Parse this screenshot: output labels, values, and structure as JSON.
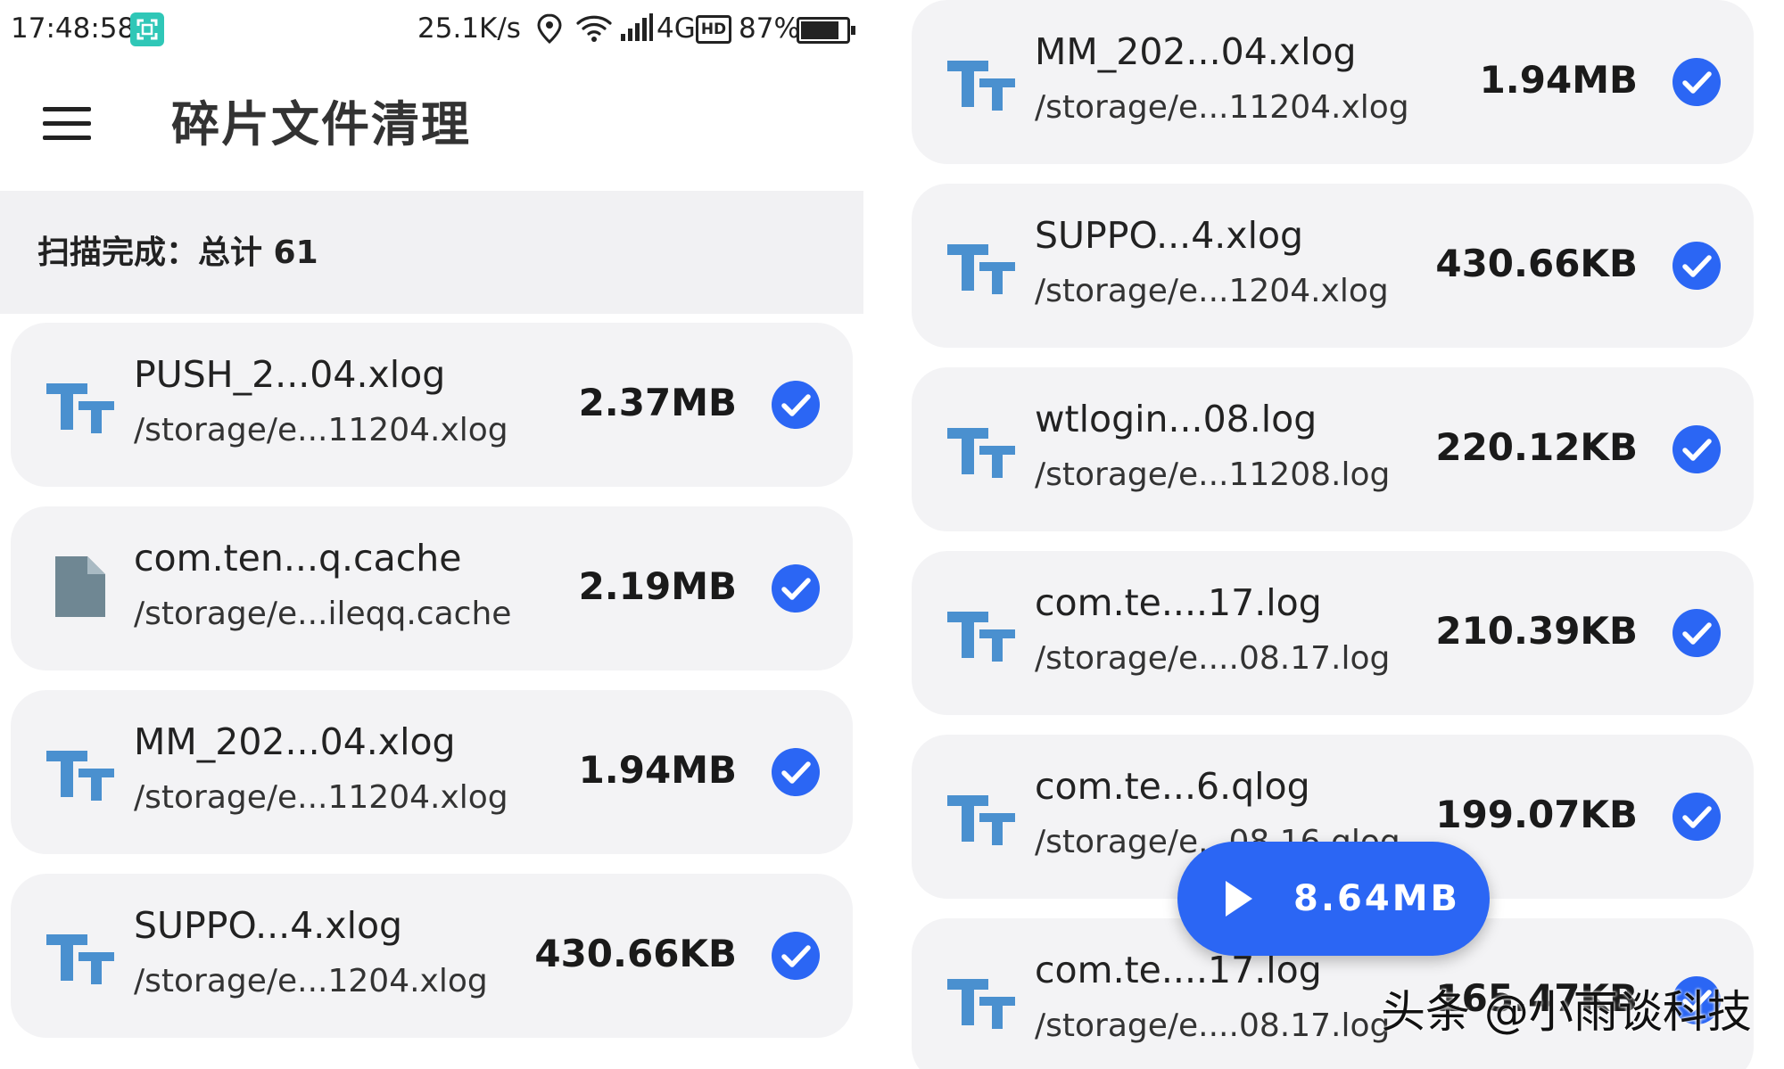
{
  "status_bar": {
    "time": "17:48:58",
    "speed": "25.1K/s",
    "network": "4G",
    "hd": "HD",
    "battery_pct": "87%",
    "battery_level": 0.87,
    "icons": [
      "screenshot-icon",
      "location-icon",
      "wifi-icon",
      "signal-icon",
      "battery-icon"
    ]
  },
  "app_bar": {
    "title": "碎片文件清理",
    "menu_icon": "hamburger-menu-icon"
  },
  "summary": {
    "text": "扫描完成：总计 61"
  },
  "left_list": [
    {
      "name": "PUSH_2...04.xlog",
      "path": "/storage/e...11204.xlog",
      "size": "2.37MB",
      "icon": "text-file-icon",
      "checked": true
    },
    {
      "name": "com.ten...q.cache",
      "path": "/storage/e...ileqq.cache",
      "size": "2.19MB",
      "icon": "generic-file-icon",
      "checked": true
    },
    {
      "name": "MM_202...04.xlog",
      "path": "/storage/e...11204.xlog",
      "size": "1.94MB",
      "icon": "text-file-icon",
      "checked": true
    },
    {
      "name": "SUPPO...4.xlog",
      "path": "/storage/e...1204.xlog",
      "size": "430.66KB",
      "icon": "text-file-icon",
      "checked": true
    }
  ],
  "right_list": [
    {
      "name": "MM_202...04.xlog",
      "path": "/storage/e...11204.xlog",
      "size": "1.94MB",
      "icon": "text-file-icon",
      "checked": true
    },
    {
      "name": "SUPPO...4.xlog",
      "path": "/storage/e...1204.xlog",
      "size": "430.66KB",
      "icon": "text-file-icon",
      "checked": true
    },
    {
      "name": "wtlogin...08.log",
      "path": "/storage/e...11208.log",
      "size": "220.12KB",
      "icon": "text-file-icon",
      "checked": true
    },
    {
      "name": "com.te....17.log",
      "path": "/storage/e....08.17.log",
      "size": "210.39KB",
      "icon": "text-file-icon",
      "checked": true
    },
    {
      "name": "com.te...6.qlog",
      "path": "/storage/e...08.16.qlog",
      "size": "199.07KB",
      "icon": "text-file-icon",
      "checked": true
    },
    {
      "name": "com.te....17.log",
      "path": "/storage/e....08.17.log",
      "size": "165.47KB",
      "icon": "text-file-icon",
      "checked": true
    }
  ],
  "fab": {
    "label": "8.64MB",
    "icon": "play-icon"
  },
  "watermark": "头条 @小雨谈科技",
  "colors": {
    "accent": "#2b66f4",
    "file_icon": "#4a90cf",
    "generic_icon": "#6f8793",
    "card_bg": "#f3f3f5"
  }
}
